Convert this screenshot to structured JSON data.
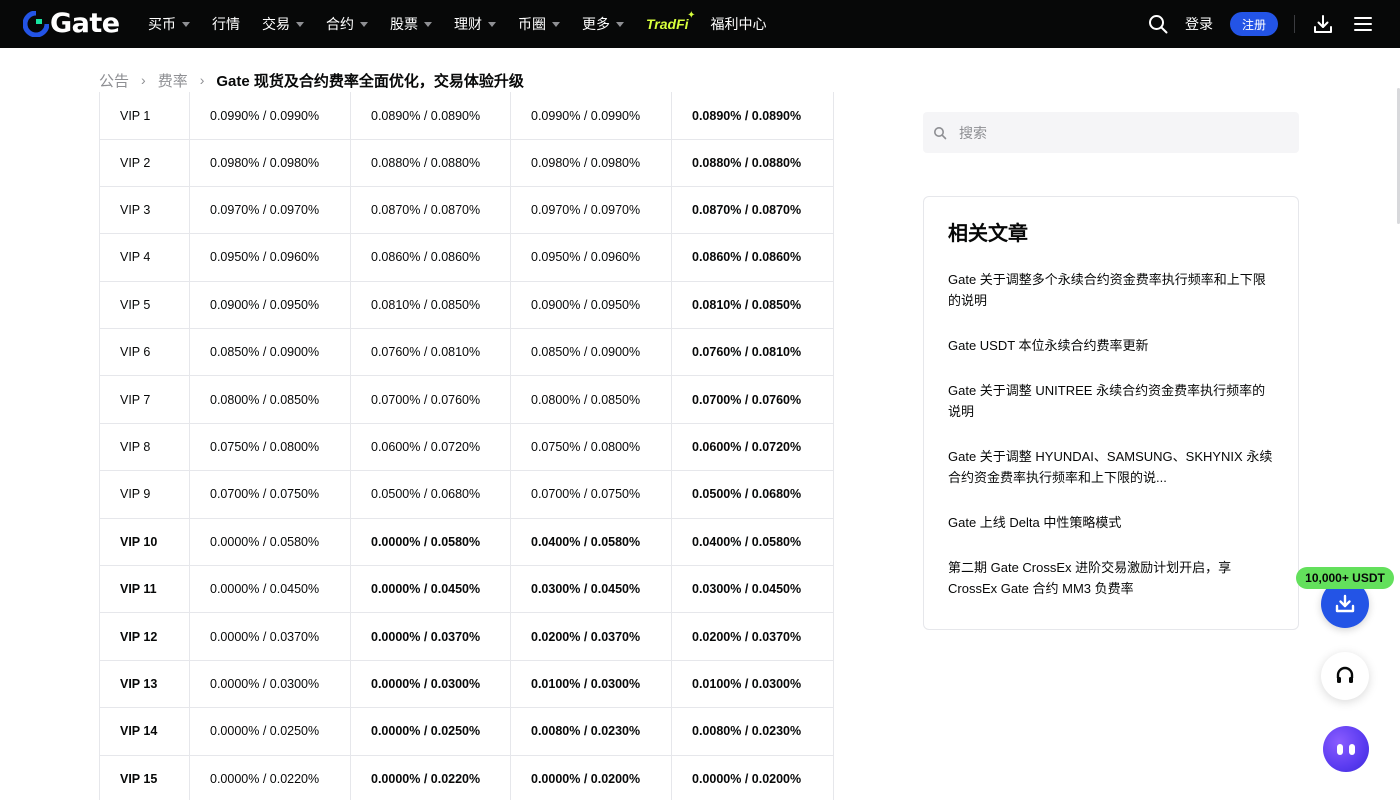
{
  "header": {
    "logo_text": "Gate",
    "nav": [
      {
        "label": "买币",
        "has_caret": true
      },
      {
        "label": "行情",
        "has_caret": false
      },
      {
        "label": "交易",
        "has_caret": true
      },
      {
        "label": "合约",
        "has_caret": true
      },
      {
        "label": "股票",
        "has_caret": true
      },
      {
        "label": "理财",
        "has_caret": true
      },
      {
        "label": "币圈",
        "has_caret": true
      },
      {
        "label": "更多",
        "has_caret": true
      }
    ],
    "tradfi_label": "TradFi",
    "rewards_label": "福利中心",
    "login_label": "登录",
    "signup_label": "注册",
    "icons": [
      "search-icon",
      "download-icon",
      "menu-icon"
    ]
  },
  "breadcrumb": {
    "items": [
      "公告",
      "费率"
    ],
    "current": "Gate 现货及合约费率全面优化，交易体验升级"
  },
  "fee_table": {
    "rows": [
      {
        "level": "VIP 1",
        "cells": [
          "0.0990% / 0.0990%",
          "0.0890% / 0.0890%",
          "0.0990% / 0.0990%",
          "0.0890% / 0.0890%"
        ],
        "bold_from": 4
      },
      {
        "level": "VIP 2",
        "cells": [
          "0.0980% / 0.0980%",
          "0.0880% / 0.0880%",
          "0.0980% / 0.0980%",
          "0.0880% / 0.0880%"
        ],
        "bold_from": 4
      },
      {
        "level": "VIP 3",
        "cells": [
          "0.0970% / 0.0970%",
          "0.0870% / 0.0870%",
          "0.0970% / 0.0970%",
          "0.0870% / 0.0870%"
        ],
        "bold_from": 4
      },
      {
        "level": "VIP 4",
        "cells": [
          "0.0950% / 0.0960%",
          "0.0860% / 0.0860%",
          "0.0950% / 0.0960%",
          "0.0860% / 0.0860%"
        ],
        "bold_from": 4
      },
      {
        "level": "VIP 5",
        "cells": [
          "0.0900% / 0.0950%",
          "0.0810% / 0.0850%",
          "0.0900% / 0.0950%",
          "0.0810% / 0.0850%"
        ],
        "bold_from": 4
      },
      {
        "level": "VIP 6",
        "cells": [
          "0.0850% / 0.0900%",
          "0.0760% / 0.0810%",
          "0.0850% / 0.0900%",
          "0.0760% / 0.0810%"
        ],
        "bold_from": 4
      },
      {
        "level": "VIP 7",
        "cells": [
          "0.0800% / 0.0850%",
          "0.0700% / 0.0760%",
          "0.0800% / 0.0850%",
          "0.0700% / 0.0760%"
        ],
        "bold_from": 4
      },
      {
        "level": "VIP 8",
        "cells": [
          "0.0750% / 0.0800%",
          "0.0600% / 0.0720%",
          "0.0750% / 0.0800%",
          "0.0600% / 0.0720%"
        ],
        "bold_from": 4
      },
      {
        "level": "VIP 9",
        "cells": [
          "0.0700% / 0.0750%",
          "0.0500% / 0.0680%",
          "0.0700% / 0.0750%",
          "0.0500% / 0.0680%"
        ],
        "bold_from": 4
      },
      {
        "level": "VIP 10",
        "cells": [
          "0.0000% / 0.0580%",
          "0.0000% / 0.0580%",
          "0.0400% / 0.0580%",
          "0.0400% / 0.0580%"
        ],
        "bold_from": 2
      },
      {
        "level": "VIP 11",
        "cells": [
          "0.0000% / 0.0450%",
          "0.0000% / 0.0450%",
          "0.0300% / 0.0450%",
          "0.0300% / 0.0450%"
        ],
        "bold_from": 2
      },
      {
        "level": "VIP 12",
        "cells": [
          "0.0000% / 0.0370%",
          "0.0000% / 0.0370%",
          "0.0200% / 0.0370%",
          "0.0200% / 0.0370%"
        ],
        "bold_from": 2
      },
      {
        "level": "VIP 13",
        "cells": [
          "0.0000% / 0.0300%",
          "0.0000% / 0.0300%",
          "0.0100% / 0.0300%",
          "0.0100% / 0.0300%"
        ],
        "bold_from": 2
      },
      {
        "level": "VIP 14",
        "cells": [
          "0.0000% / 0.0250%",
          "0.0000% / 0.0250%",
          "0.0080% / 0.0230%",
          "0.0080% / 0.0230%"
        ],
        "bold_from": 2
      },
      {
        "level": "VIP 15",
        "cells": [
          "0.0000% / 0.0220%",
          "0.0000% / 0.0220%",
          "0.0000% / 0.0200%",
          "0.0000% / 0.0200%"
        ],
        "bold_from": 2
      }
    ]
  },
  "sidebar": {
    "search_placeholder": "搜索",
    "related_title": "相关文章",
    "related_articles": [
      "Gate 关于调整多个永续合约资金费率执行频率和上下限的说明",
      "Gate USDT 本位永续合约费率更新",
      "Gate 关于调整 UNITREE 永续合约资金费率执行频率的说明",
      "Gate 关于调整 HYUNDAI、SAMSUNG、SKHYNIX 永续合约资金费率执行频率和上下限的说...",
      "Gate 上线 Delta 中性策略模式",
      "第二期 Gate CrossEx 进阶交易激励计划开启，享 CrossEx Gate 合约 MM3 负费率"
    ]
  },
  "floating": {
    "promo_badge": "10,000+ USDT",
    "icons": [
      "app-download-icon",
      "support-headset-icon",
      "ai-assistant-icon"
    ]
  },
  "colors": {
    "topbar_bg": "#070808",
    "brand_blue": "#2354e6",
    "tradfi_yellow": "#d7ff3c",
    "promo_green": "#63e05c",
    "border": "#e6e7eb",
    "muted_text": "#8e8f93"
  }
}
